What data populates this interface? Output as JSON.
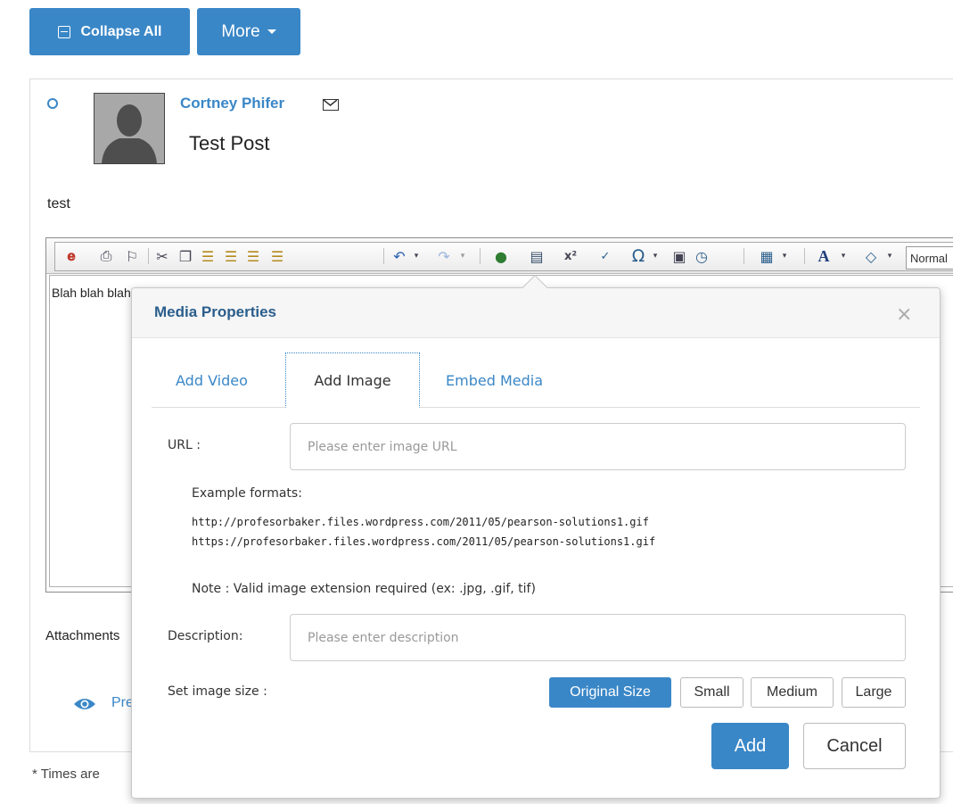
{
  "toolbar_top": {
    "collapse_label": "Collapse All",
    "more_label": "More"
  },
  "post": {
    "author": "Cortney Phifer",
    "title": "Test Post",
    "body": "test"
  },
  "editor": {
    "format_value": "Normal",
    "content": "Blah blah blah"
  },
  "page": {
    "attachments_label": "Attachments",
    "preview_label": "Preview",
    "footnote": "* Times are"
  },
  "modal": {
    "title": "Media Properties",
    "close_symbol": "×",
    "tabs": [
      {
        "label": "Add Video"
      },
      {
        "label": "Add Image"
      },
      {
        "label": "Embed Media"
      }
    ],
    "url_label": "URL :",
    "url_placeholder": "Please enter image URL",
    "example_heading": "Example formats:",
    "example_1": "http://profesorbaker.files.wordpress.com/2011/05/pearson-solutions1.gif",
    "example_2": "https://profesorbaker.files.wordpress.com/2011/05/pearson-solutions1.gif",
    "note": "Note : Valid image extension required (ex: .jpg, .gif, tif)",
    "description_label": "Description:",
    "description_placeholder": "Please enter description",
    "size_label": "Set image size :",
    "sizes": [
      {
        "label": "Original Size"
      },
      {
        "label": "Small"
      },
      {
        "label": "Medium"
      },
      {
        "label": "Large"
      }
    ],
    "add_label": "Add",
    "cancel_label": "Cancel"
  },
  "colors": {
    "accent": "#3a87c7",
    "title_blue": "#2b5e8c"
  }
}
